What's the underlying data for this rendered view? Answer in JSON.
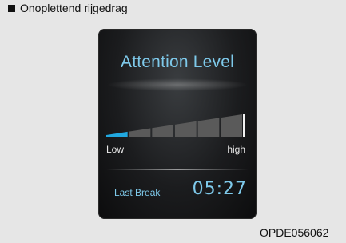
{
  "caption": {
    "text": "Onoplettend rijgedrag",
    "bullet_icon": "square-bullet-icon"
  },
  "display": {
    "title": "Attention Level",
    "meter": {
      "label_low": "Low",
      "label_high": "high",
      "segments_total": 6,
      "active_segments": 1,
      "active_color": "#21a8e0",
      "inactive_color": "#5a5a5a"
    },
    "last_break": {
      "label": "Last Break",
      "time": "05:27"
    },
    "accent_color": "#7ec9ea"
  },
  "figure_code": "OPDE056062"
}
